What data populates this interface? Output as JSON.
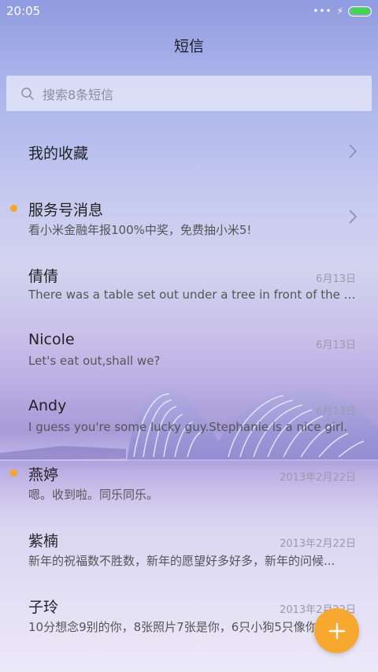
{
  "status_bar": {
    "time": "20:05",
    "dots": "•••",
    "bolt": "⚡"
  },
  "header": {
    "title": "短信"
  },
  "search": {
    "placeholder": "搜索8条短信"
  },
  "favorites": {
    "label": "我的收藏"
  },
  "service": {
    "label": "服务号消息",
    "preview": "看小米金融年报100%中奖，免费抽小米5!",
    "unread": true
  },
  "conversations": [
    {
      "name": "倩倩",
      "preview": "There was a table set out under a tree in front of the ho...",
      "date": "6月13日",
      "unread": false
    },
    {
      "name": "Nicole",
      "preview": "Let's eat out,shall we?",
      "date": "6月13日",
      "unread": false
    },
    {
      "name": "Andy",
      "preview": "I guess you're some lucky guy.Stephanie is a nice girl.",
      "date": "6月13日",
      "unread": false
    },
    {
      "name": "燕婷",
      "preview": "嗯。收到啦。同乐同乐。",
      "date": "2013年2月22日",
      "unread": true
    },
    {
      "name": "紫楠",
      "preview": "新年的祝福数不胜数，新年的愿望好多好多，新年的问候...",
      "date": "2013年2月22日",
      "unread": false
    },
    {
      "name": "子玲",
      "preview": "10分想念9别的你，8张照片7张是你，6只小狗5只像你",
      "date": "2013年2月22日",
      "unread": false
    }
  ],
  "colors": {
    "accent": "#f7a92f",
    "unread": "#f6a623",
    "battery": "#3fd94a"
  },
  "fab": {
    "icon": "plus-icon"
  }
}
